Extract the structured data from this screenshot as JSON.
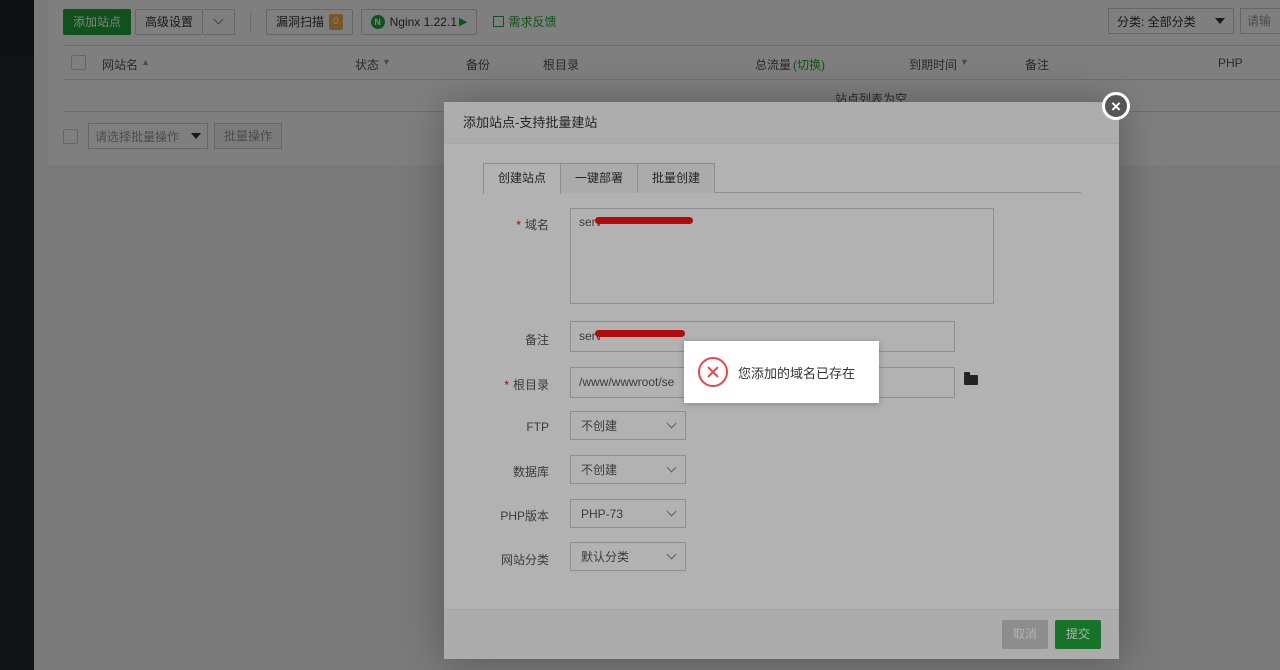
{
  "toolbar": {
    "add_site": "添加站点",
    "advanced": "高级设置",
    "vuln_scan": "漏洞扫描",
    "vuln_count": "0",
    "nginx": "Nginx 1.22.1",
    "feedback": "需求反馈",
    "category": "分类: 全部分类",
    "search_placeholder": "请输"
  },
  "table": {
    "columns": [
      "网站名",
      "状态",
      "备份",
      "根目录",
      "总流量",
      "切换",
      "到期时间",
      "备注",
      "PHP"
    ],
    "empty_text": "站点列表为空"
  },
  "batch": {
    "select_placeholder": "请选择批量操作",
    "button": "批量操作"
  },
  "dialog": {
    "title": "添加站点-支持批量建站",
    "tabs": [
      "创建站点",
      "一键部署",
      "批量创建"
    ],
    "labels": {
      "domain": "域名",
      "remark": "备注",
      "root": "根目录",
      "ftp": "FTP",
      "database": "数据库",
      "php": "PHP版本",
      "category": "网站分类"
    },
    "values": {
      "domain": "serv",
      "remark": "serv",
      "root": "/www/wwwroot/se",
      "ftp": "不创建",
      "database": "不创建",
      "php": "PHP-73",
      "category": "默认分类"
    },
    "cancel": "取消",
    "submit": "提交"
  },
  "toast": {
    "message": "您添加的域名已存在"
  },
  "colors": {
    "accent": "#20a53a",
    "error": "#e8464b"
  }
}
